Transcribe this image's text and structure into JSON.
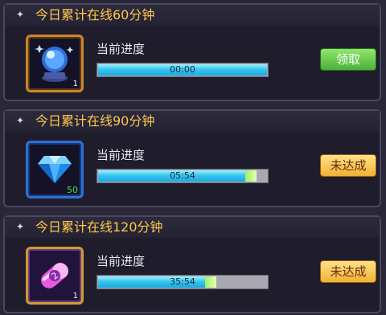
{
  "tasks": [
    {
      "title": "今日累计在线60分钟",
      "icon": "crystal-ball-icon",
      "item_count": "1",
      "progress_label": "当前进度",
      "time": "00:00",
      "progress": 1.0,
      "button_label": "领取",
      "button_style": "green"
    },
    {
      "title": "今日累计在线90分钟",
      "icon": "blue-diamond-icon",
      "item_count": "50",
      "progress_label": "当前进度",
      "time": "05:54",
      "progress": 0.94,
      "button_label": "未达成",
      "button_style": "gold"
    },
    {
      "title": "今日累计在线120分钟",
      "icon": "purple-capsule-icon",
      "item_count": "1",
      "progress_label": "当前进度",
      "time": "35:54",
      "progress": 0.7,
      "button_label": "未达成",
      "button_style": "gold"
    }
  ],
  "colors": {
    "title": "#ffc84a",
    "bar_fill": "#38c6ee",
    "button_green": "#5cc040",
    "button_gold": "#f4c04a"
  }
}
